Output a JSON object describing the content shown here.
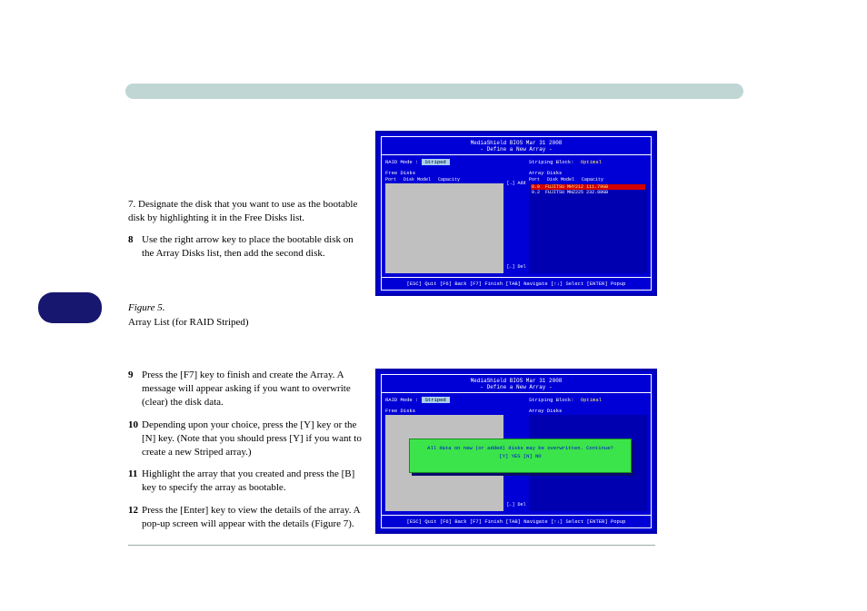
{
  "bios": {
    "title_line1": "MediaShield BIOS   Mar 31 2008",
    "title_line2": "- Define a New Array -",
    "raid_mode_label": "RAID Mode :",
    "raid_mode_value": "Striped",
    "striping_block_label": "Striping Block:",
    "striping_block_value": "Optimal",
    "free_disks_label": "Free Disks",
    "array_disks_label": "Array Disks",
    "col_port": "Port",
    "col_model": "Disk Model",
    "col_capacity": "Capacity",
    "add_label": "[→] Add",
    "del_label": "[←] Del",
    "array_rows": [
      {
        "port": "0.0",
        "model": "FUJITSU MHY212",
        "cap": "111.79GB",
        "highlight": true
      },
      {
        "port": "0.2",
        "model": "FUJITSU MHZ225",
        "cap": "232.88GB",
        "highlight": false
      }
    ],
    "footer": "[ESC] Quit  [F6] Back  [F7] Finish  [TAB] Navigate [↑↓] Select [ENTER] Popup"
  },
  "popup": {
    "line1": "All data on new (or added) disks may be overwritten. Continue?",
    "line2": "[Y] YES   [N] NO"
  },
  "text": {
    "step7": "7. Designate the disk that you want to use as the bootable disk by highlighting it in the Free Disks list.",
    "step8": "Use the right arrow key to place the bootable disk on the Array Disks list, then add the second disk.",
    "figure_badge_label": "Figure 5",
    "fig1cap": "Figure 5.",
    "array_list_label": "Array List (for RAID Striped)",
    "step9": "Press the [F7] key to finish and create the Array. A message will appear asking if you want to overwrite (clear) the disk data.",
    "step10": "Depending upon your choice, press the [Y] key or the [N] key. (Note that you should press [Y] if you want to create a new Striped array.)",
    "step11": "Highlight the array that you created and press the [B] key to specify the array as bootable.",
    "step12": "Press the [Enter] key to view the details of the array. A pop-up screen will appear with the details (Figure 7)."
  },
  "chart_data": {
    "type": "table",
    "title": "Array Disks",
    "columns": [
      "Port",
      "Disk Model",
      "Capacity"
    ],
    "rows": [
      [
        "0.0",
        "FUJITSU MHY212",
        "111.79GB"
      ],
      [
        "0.2",
        "FUJITSU MHZ225",
        "232.88GB"
      ]
    ]
  }
}
